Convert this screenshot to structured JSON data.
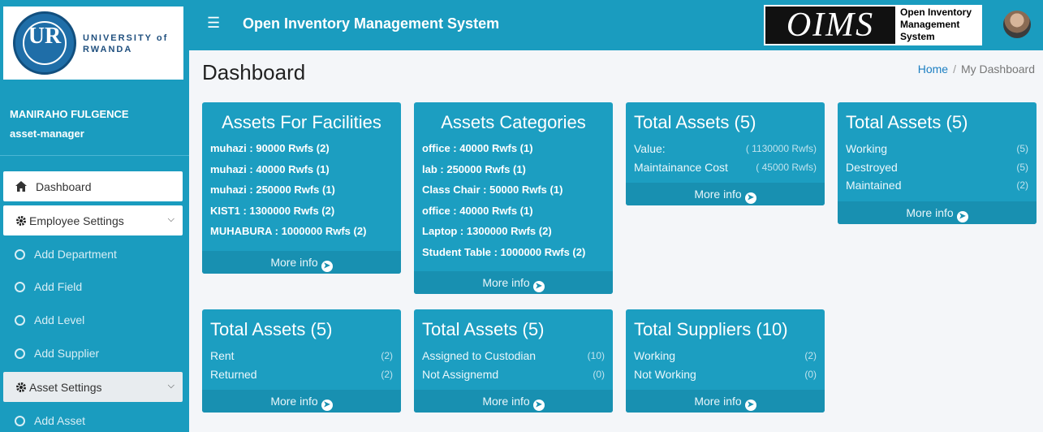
{
  "sidebar": {
    "logo": {
      "mark": "UR",
      "line1": "UNIVERSITY of",
      "line2": "RWANDA"
    },
    "user": {
      "name": "MANIRAHO FULGENCE",
      "role": "asset-manager"
    },
    "dashboard_label": "Dashboard",
    "employee_settings_label": "Employee Settings",
    "employee_items": [
      "Add Department",
      "Add Field",
      "Add Level",
      "Add Supplier"
    ],
    "asset_settings_label": "Asset Settings",
    "asset_items": [
      "Add Asset"
    ]
  },
  "header": {
    "title": "Open Inventory Management System",
    "brand_logo": "OIMS",
    "brand_line1": "Open Inventory",
    "brand_line2": "Management",
    "brand_line3": "System"
  },
  "page": {
    "title": "Dashboard",
    "breadcrumb_home": "Home",
    "breadcrumb_sep": "/",
    "breadcrumb_current": "My Dashboard"
  },
  "more_info_label": "More info",
  "cards": {
    "facilities": {
      "title": "Assets For Facilities",
      "lines": [
        "muhazi : 90000 Rwfs (2)",
        "muhazi : 40000 Rwfs (1)",
        "muhazi : 250000 Rwfs (1)",
        "KIST1 : 1300000 Rwfs (2)",
        "MUHABURA : 1000000 Rwfs (2)"
      ]
    },
    "categories": {
      "title": "Assets Categories",
      "lines": [
        "office : 40000 Rwfs (1)",
        "lab : 250000 Rwfs (1)",
        "Class Chair : 50000 Rwfs (1)",
        "office : 40000 Rwfs (1)",
        "Laptop : 1300000 Rwfs (2)",
        "Student Table : 1000000 Rwfs (2)"
      ]
    },
    "total_value": {
      "title": "Total Assets (5)",
      "rows": [
        {
          "label": "Value:",
          "value": "( 1130000 Rwfs)"
        },
        {
          "label": "Maintainance Cost",
          "value": "( 45000 Rwfs)"
        }
      ]
    },
    "total_status": {
      "title": "Total Assets (5)",
      "rows": [
        {
          "label": "Working",
          "value": "(5)"
        },
        {
          "label": "Destroyed",
          "value": "(5)"
        },
        {
          "label": "Maintained",
          "value": "(2)"
        }
      ]
    },
    "total_rent": {
      "title": "Total Assets (5)",
      "rows": [
        {
          "label": "Rent",
          "value": "(2)"
        },
        {
          "label": "Returned",
          "value": "(2)"
        }
      ]
    },
    "total_custodian": {
      "title": "Total Assets (5)",
      "rows": [
        {
          "label": "Assigned to Custodian",
          "value": "(10)"
        },
        {
          "label": "Not Assignemd",
          "value": "(0)"
        }
      ]
    },
    "suppliers": {
      "title": "Total Suppliers (10)",
      "rows": [
        {
          "label": "Working",
          "value": "(2)"
        },
        {
          "label": "Not Working",
          "value": "(0)"
        }
      ]
    }
  },
  "colors": {
    "primary": "#1a9cbf",
    "card": "#1c9ec1",
    "card_footer": "#1890b1",
    "background": "#f4f6f9"
  }
}
